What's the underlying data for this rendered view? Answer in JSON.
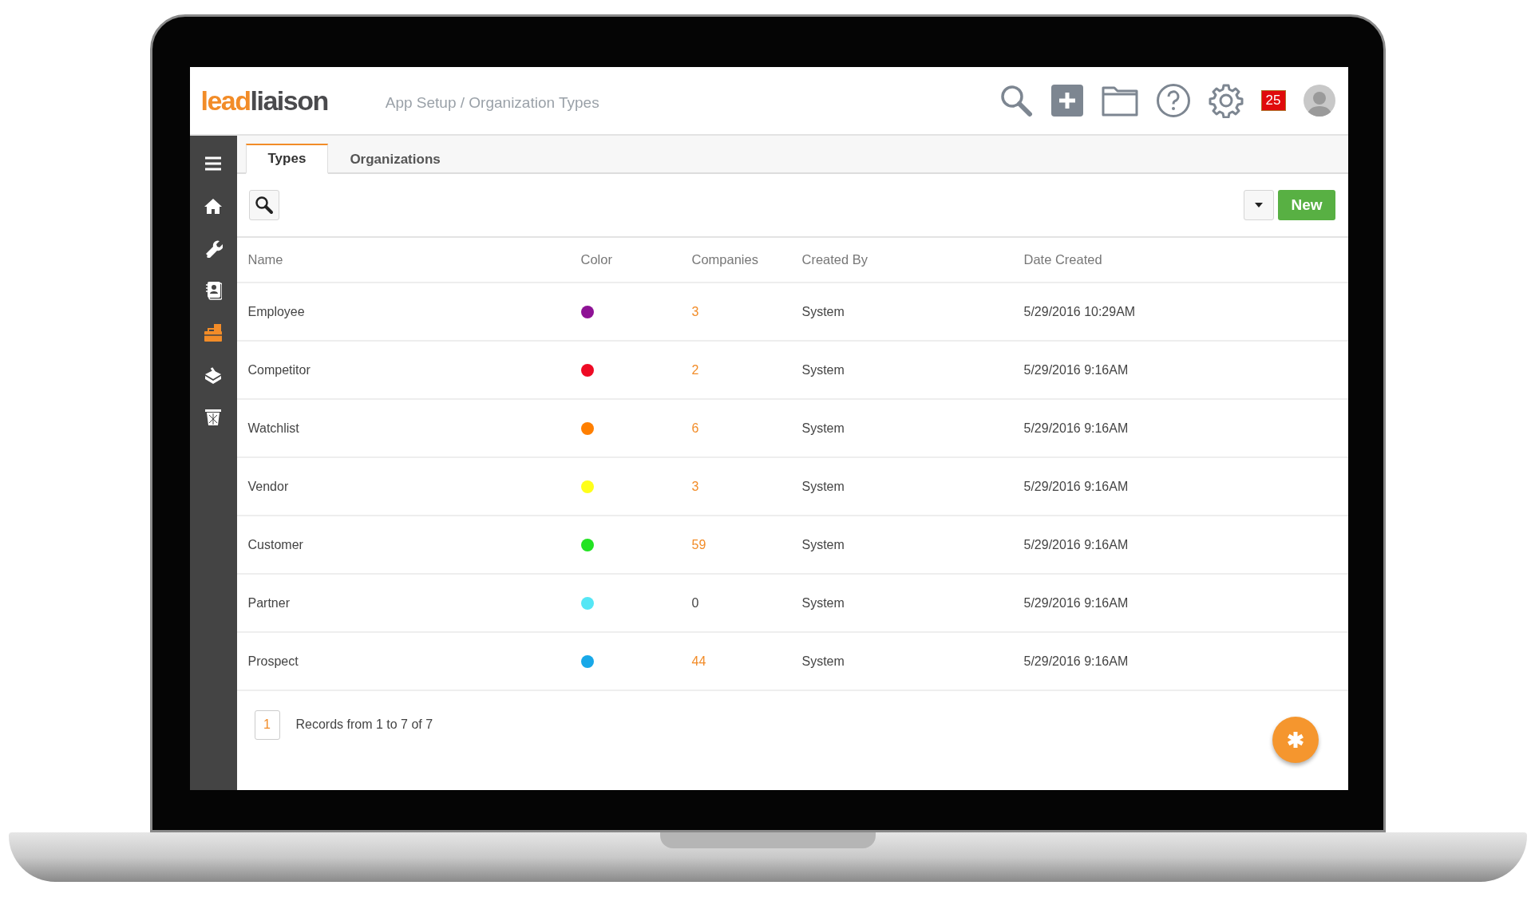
{
  "header": {
    "logo": {
      "lead": "lead",
      "rest": "liaison"
    },
    "breadcrumb": "App Setup / Organization Types",
    "notification_count": "25"
  },
  "sidebar": {
    "items": [
      {
        "selected": false
      },
      {
        "selected": false
      },
      {
        "selected": false
      },
      {
        "selected": true
      },
      {
        "selected": false
      },
      {
        "selected": false
      }
    ]
  },
  "tabs": [
    {
      "label": "Types",
      "selected": true
    },
    {
      "label": "Organizations",
      "selected": false
    }
  ],
  "toolbar": {
    "new_button": "New"
  },
  "table": {
    "columns": [
      "Name",
      "Color",
      "Companies",
      "Created By",
      "Date Created"
    ],
    "rows": [
      {
        "name": "Employee",
        "color": "#8e1295",
        "companies": "3",
        "companies_link": true,
        "created_by": "System",
        "date_created": "5/29/2016 10:29AM"
      },
      {
        "name": "Competitor",
        "color": "#ee0a24",
        "companies": "2",
        "companies_link": true,
        "created_by": "System",
        "date_created": "5/29/2016 9:16AM"
      },
      {
        "name": "Watchlist",
        "color": "#ff7f00",
        "companies": "6",
        "companies_link": true,
        "created_by": "System",
        "date_created": "5/29/2016 9:16AM"
      },
      {
        "name": "Vendor",
        "color": "#ffff1a",
        "companies": "3",
        "companies_link": true,
        "created_by": "System",
        "date_created": "5/29/2016 9:16AM"
      },
      {
        "name": "Customer",
        "color": "#22e322",
        "companies": "59",
        "companies_link": true,
        "created_by": "System",
        "date_created": "5/29/2016 9:16AM"
      },
      {
        "name": "Partner",
        "color": "#55e6f5",
        "companies": "0",
        "companies_link": false,
        "created_by": "System",
        "date_created": "5/29/2016 9:16AM"
      },
      {
        "name": "Prospect",
        "color": "#18a8e8",
        "companies": "44",
        "companies_link": true,
        "created_by": "System",
        "date_created": "5/29/2016 9:16AM"
      }
    ]
  },
  "pagination": {
    "pages": [
      {
        "label": "1",
        "selected": true
      }
    ],
    "summary": "Records from 1 to 7 of 7"
  }
}
